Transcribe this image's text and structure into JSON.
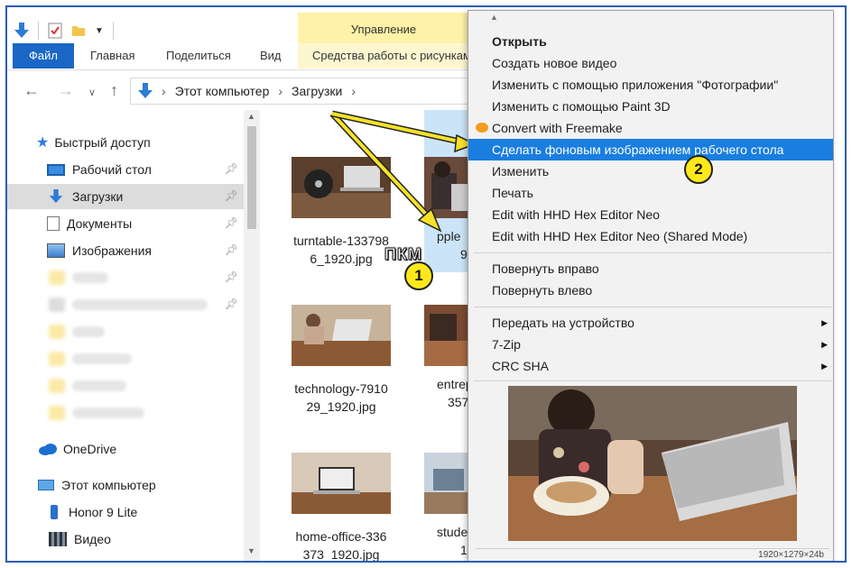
{
  "ribbon": {
    "manage_group": "Управление",
    "tabs": [
      "Файл",
      "Главная",
      "Поделиться",
      "Вид"
    ],
    "tools_tab": "Средства работы с рисунками"
  },
  "address": {
    "crumbs": [
      "Этот компьютер",
      "Загрузки"
    ]
  },
  "sidebar": {
    "quick_access": "Быстрый доступ",
    "items": [
      {
        "label": "Рабочий стол",
        "icon": "desktop-icon"
      },
      {
        "label": "Загрузки",
        "icon": "downloads-icon"
      },
      {
        "label": "Документы",
        "icon": "documents-icon"
      },
      {
        "label": "Изображения",
        "icon": "pictures-icon"
      }
    ],
    "onedrive": "OneDrive",
    "this_pc": "Этот компьютер",
    "pc_items": [
      {
        "label": "Honor 9 Lite",
        "icon": "phone-icon"
      },
      {
        "label": "Видео",
        "icon": "video-icon"
      }
    ]
  },
  "files": [
    {
      "line1": "turntable-133798",
      "line2": "6_1920.jpg"
    },
    {
      "line1": "pple",
      "line2": "9"
    },
    {
      "line1": "technology-7910",
      "line2": "29_1920.jpg"
    },
    {
      "line1": "entrep",
      "line2": "357_"
    },
    {
      "line1": "home-office-336",
      "line2": "373_1920.jpg"
    },
    {
      "line1": "stude",
      "line2": "19"
    }
  ],
  "context_menu": {
    "items": [
      "Открыть",
      "Создать новое видео",
      "Изменить с помощью приложения \"Фотографии\"",
      "Изменить с помощью Paint 3D",
      "Convert with Freemake",
      "Сделать фоновым изображением рабочего стола",
      "Изменить",
      "Печать",
      "Edit with HHD Hex Editor Neo",
      "Edit with HHD Hex Editor Neo (Shared Mode)",
      "Повернуть вправо",
      "Повернуть влево",
      "Передать на устройство",
      "7-Zip",
      "CRC SHA"
    ],
    "status": "1920×1279×24b"
  },
  "annotations": {
    "pkm": "ПКМ",
    "badge1": "1",
    "badge2": "2"
  },
  "colors": {
    "accent": "#1a67c6",
    "highlight": "#1a7de0",
    "badge": "#ffe81a",
    "arrow": "#f5e12a"
  }
}
